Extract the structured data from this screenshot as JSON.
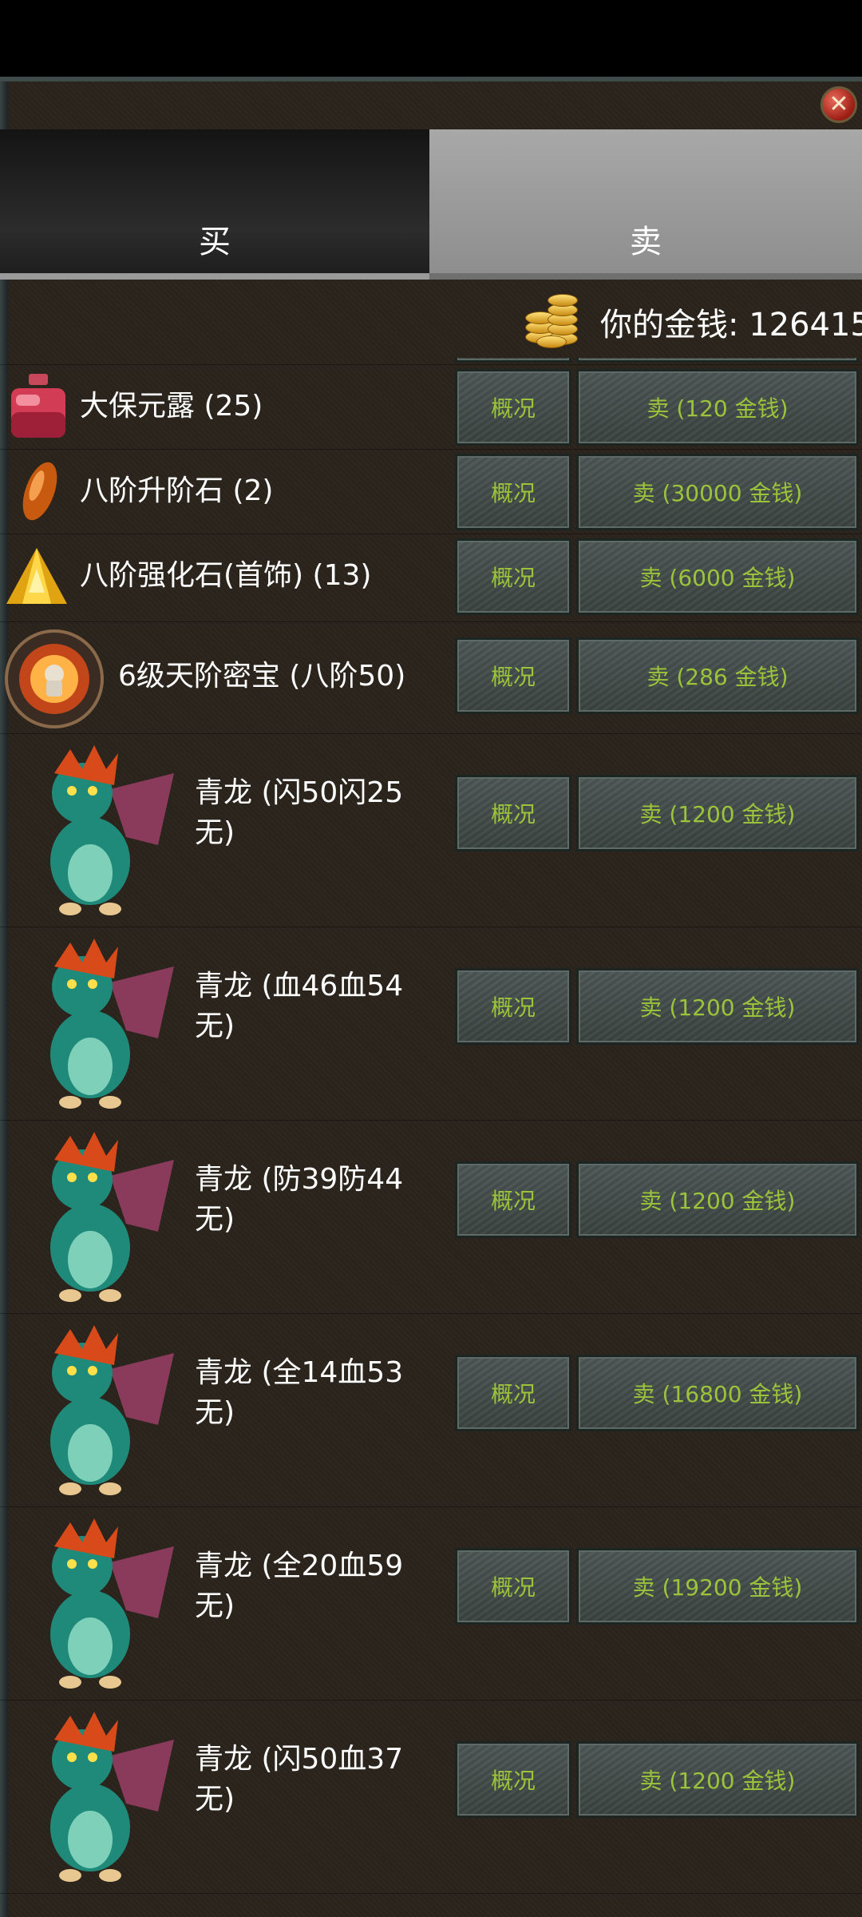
{
  "tabs": {
    "buy": "买",
    "sell": "卖"
  },
  "money": {
    "label": "你的金钱: 126415"
  },
  "close": {
    "glyph": "✕"
  },
  "buttons": {
    "detail": "概况"
  },
  "items": [
    {
      "name": "大保元露 (25)",
      "sell": "卖 (120 金钱)",
      "icon": "potion-icon"
    },
    {
      "name": "八阶升阶石 (2)",
      "sell": "卖 (30000 金钱)",
      "icon": "stone-icon"
    },
    {
      "name": "八阶强化石(首饰) (13)",
      "sell": "卖 (6000 金钱)",
      "icon": "gem-icon"
    },
    {
      "name": "6级天阶密宝 (八阶50)",
      "sell": "卖 (286 金钱)",
      "icon": "treasure-icon"
    },
    {
      "name": "青龙 (闪50闪25无)",
      "line1": "青龙 (闪50闪25",
      "line2": "无)",
      "sell": "卖 (1200 金钱)",
      "icon": "dragon-icon"
    },
    {
      "name": "青龙 (血46血54无)",
      "line1": "青龙 (血46血54",
      "line2": "无)",
      "sell": "卖 (1200 金钱)",
      "icon": "dragon-icon"
    },
    {
      "name": "青龙 (防39防44无)",
      "line1": "青龙 (防39防44",
      "line2": "无)",
      "sell": "卖 (1200 金钱)",
      "icon": "dragon-icon"
    },
    {
      "name": "青龙 (全14血53无)",
      "line1": "青龙 (全14血53",
      "line2": "无)",
      "sell": "卖 (16800 金钱)",
      "icon": "dragon-icon"
    },
    {
      "name": "青龙 (全20血59无)",
      "line1": "青龙 (全20血59",
      "line2": "无)",
      "sell": "卖 (19200 金钱)",
      "icon": "dragon-icon"
    },
    {
      "name": "青龙 (闪50血37无)",
      "line1": "青龙 (闪50血37",
      "line2": "无)",
      "sell": "卖 (1200 金钱)",
      "icon": "dragon-icon"
    }
  ]
}
